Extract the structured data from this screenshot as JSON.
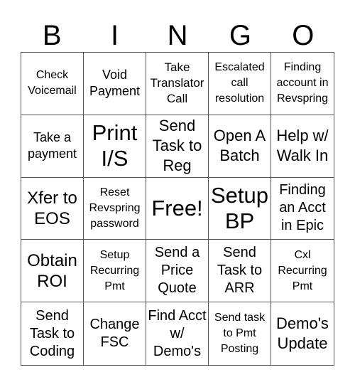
{
  "header": {
    "letters": [
      "B",
      "I",
      "N",
      "G",
      "O"
    ]
  },
  "cells": [
    "Check Voicemail",
    "Void Payment",
    "Take Translator Call",
    "Escalated call resolution",
    "Finding account in Revspring",
    "Take a payment",
    "Print I/S",
    "Send Task to Reg",
    "Open A Batch",
    "Help w/ Walk In",
    "Xfer to EOS",
    "Reset Revspring password",
    "Free!",
    "Setup BP",
    "Finding an Acct in Epic",
    "Obtain ROI",
    "Setup Recurring Pmt",
    "Send a Price Quote",
    "Send Task to ARR",
    "Cxl Recurring Pmt",
    "Send Task to Coding",
    "Change FSC",
    "Find Acct w/ Demo's",
    "Send task to Pmt Posting",
    "Demo's Update"
  ]
}
